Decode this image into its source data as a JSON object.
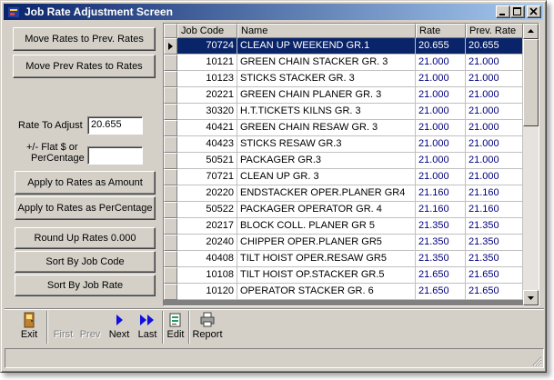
{
  "window": {
    "title": "Job Rate Adjustment Screen",
    "icons": {
      "app": "app-icon",
      "minimize": "minimize-icon",
      "maximize": "maximize-icon",
      "close": "close-icon"
    }
  },
  "left_panel": {
    "move_to_prev_label": "Move Rates to Prev. Rates",
    "move_prev_to_rates_label": "Move Prev Rates to Rates",
    "rate_to_adjust_label": "Rate To Adjust",
    "rate_to_adjust_value": "20.655",
    "flat_label_line1": "+/- Flat $ or",
    "flat_label_line2": "PerCentage",
    "flat_value": "",
    "apply_amount_label": "Apply to Rates as Amount",
    "apply_percentage_label": "Apply to Rates as PerCentage",
    "round_up_label": "Round Up Rates 0.000",
    "sort_job_code_label": "Sort By Job Code",
    "sort_job_rate_label": "Sort By Job Rate"
  },
  "grid": {
    "columns": [
      "Job Code",
      "Name",
      "Rate",
      "Prev. Rate"
    ],
    "selected_index": 0,
    "rows": [
      {
        "code": "70724",
        "name": "CLEAN UP WEEKEND GR.1",
        "rate": "20.655",
        "prev": "20.655"
      },
      {
        "code": "10121",
        "name": "GREEN CHAIN STACKER GR. 3",
        "rate": "21.000",
        "prev": "21.000"
      },
      {
        "code": "10123",
        "name": "STICKS STACKER GR. 3",
        "rate": "21.000",
        "prev": "21.000"
      },
      {
        "code": "20221",
        "name": "GREEN CHAIN PLANER GR. 3",
        "rate": "21.000",
        "prev": "21.000"
      },
      {
        "code": "30320",
        "name": "H.T.TICKETS KILNS GR. 3",
        "rate": "21.000",
        "prev": "21.000"
      },
      {
        "code": "40421",
        "name": "GREEN CHAIN RESAW GR. 3",
        "rate": "21.000",
        "prev": "21.000"
      },
      {
        "code": "40423",
        "name": "STICKS RESAW GR.3",
        "rate": "21.000",
        "prev": "21.000"
      },
      {
        "code": "50521",
        "name": "PACKAGER GR.3",
        "rate": "21.000",
        "prev": "21.000"
      },
      {
        "code": "70721",
        "name": "CLEAN UP GR. 3",
        "rate": "21.000",
        "prev": "21.000"
      },
      {
        "code": "20220",
        "name": "ENDSTACKER OPER.PLANER GR4",
        "rate": "21.160",
        "prev": "21.160"
      },
      {
        "code": "50522",
        "name": "PACKAGER OPERATOR GR. 4",
        "rate": "21.160",
        "prev": "21.160"
      },
      {
        "code": "20217",
        "name": "BLOCK COLL. PLANER GR 5",
        "rate": "21.350",
        "prev": "21.350"
      },
      {
        "code": "20240",
        "name": "CHIPPER OPER.PLANER GR5",
        "rate": "21.350",
        "prev": "21.350"
      },
      {
        "code": "40408",
        "name": "TILT HOIST OPER.RESAW GR5",
        "rate": "21.350",
        "prev": "21.350"
      },
      {
        "code": "10108",
        "name": "TILT HOIST OP.STACKER GR.5",
        "rate": "21.650",
        "prev": "21.650"
      },
      {
        "code": "10120",
        "name": "OPERATOR STACKER GR. 6",
        "rate": "21.650",
        "prev": "21.650"
      }
    ],
    "scroll_position": 0
  },
  "toolbar": {
    "exit_label": "Exit",
    "first_label": "First",
    "prev_label": "Prev",
    "next_label": "Next",
    "last_label": "Last",
    "edit_label": "Edit",
    "report_label": "Report",
    "first_enabled": false,
    "prev_enabled": false,
    "icons": {
      "exit": "door-icon",
      "next": "arrow-right-icon",
      "last": "double-arrow-right-icon",
      "edit": "edit-icon",
      "report": "printer-icon"
    }
  },
  "colors": {
    "titlebar_start": "#0a246a",
    "titlebar_end": "#a6caf0",
    "selection": "#0a246a",
    "rate_text": "#00007f",
    "face": "#d4d0c8"
  }
}
